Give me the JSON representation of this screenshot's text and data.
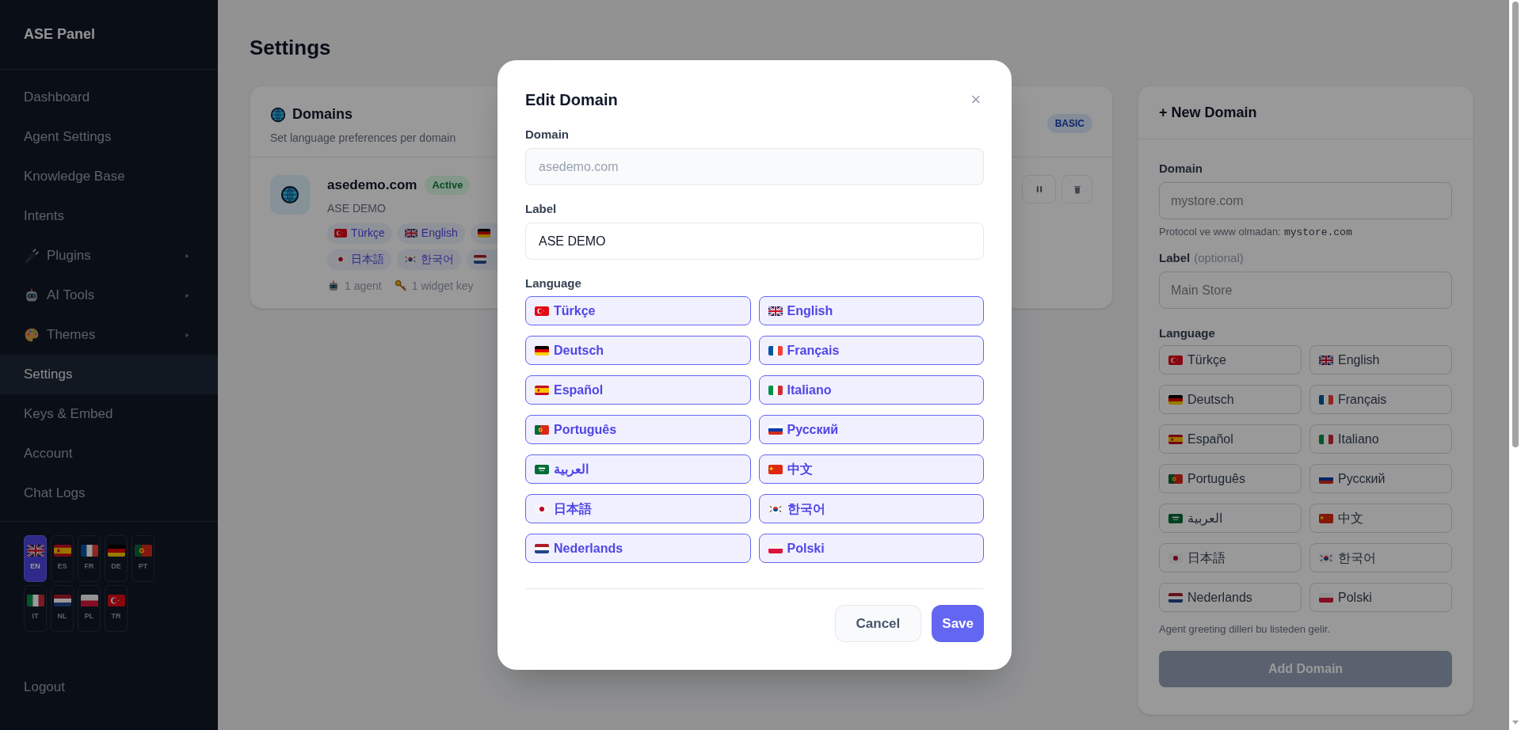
{
  "sidebar": {
    "title": "ASE Panel",
    "items": [
      {
        "label": "Dashboard",
        "kind": "link",
        "selected": false
      },
      {
        "label": "Agent Settings",
        "kind": "link",
        "selected": false
      },
      {
        "label": "Knowledge Base",
        "kind": "link",
        "selected": false
      },
      {
        "label": "Intents",
        "kind": "link",
        "selected": false
      },
      {
        "label": "Plugins",
        "kind": "plug",
        "selected": false
      },
      {
        "label": "AI Tools",
        "kind": "robot",
        "selected": false
      },
      {
        "label": "Themes",
        "kind": "palette",
        "selected": false
      },
      {
        "label": "Settings",
        "kind": "link",
        "selected": true
      },
      {
        "label": "Keys & Embed",
        "kind": "link",
        "selected": false
      },
      {
        "label": "Account",
        "kind": "link",
        "selected": false
      },
      {
        "label": "Chat Logs",
        "kind": "link",
        "selected": false
      }
    ],
    "languages": [
      {
        "code": "EN",
        "kind": "gb",
        "selected": true
      },
      {
        "code": "ES",
        "kind": "es",
        "selected": false
      },
      {
        "code": "FR",
        "kind": "fr",
        "selected": false
      },
      {
        "code": "DE",
        "kind": "de",
        "selected": false
      },
      {
        "code": "PT",
        "kind": "pt",
        "selected": false
      },
      {
        "code": "IT",
        "kind": "it",
        "selected": false
      },
      {
        "code": "NL",
        "kind": "nl",
        "selected": false
      },
      {
        "code": "PL",
        "kind": "pl",
        "selected": false
      },
      {
        "code": "TR",
        "kind": "tr",
        "selected": false
      }
    ],
    "logout": "Logout"
  },
  "page": {
    "title": "Settings"
  },
  "domains_card": {
    "title": "Domains",
    "subtitle": "Set language preferences per domain",
    "badge": "BASIC",
    "domain": {
      "name": "asedemo.com",
      "status": "Active",
      "label": "ASE DEMO",
      "language_rows": [
        [
          {
            "kind": "tr",
            "label": "Türkçe"
          },
          {
            "kind": "gb",
            "label": "English"
          },
          {
            "kind": "de"
          }
        ],
        [
          {
            "kind": "jp",
            "label": "日本語"
          },
          {
            "kind": "kr",
            "label": "한국어"
          },
          {
            "kind": "nl"
          }
        ]
      ],
      "agents": "1 agent",
      "keys": "1 widget key"
    }
  },
  "new_domain": {
    "title": "+ New Domain",
    "domain_label": "Domain",
    "domain_placeholder": "mystore.com",
    "hint": "Protocol ve www olmadan:",
    "hint_code": "mystore.com",
    "label_label": "Label",
    "label_optional": "(optional)",
    "label_placeholder": "Main Store",
    "language_label": "Language",
    "languages": [
      {
        "kind": "tr",
        "label": "Türkçe",
        "selected": false
      },
      {
        "kind": "gb",
        "label": "English",
        "selected": false
      },
      {
        "kind": "de",
        "label": "Deutsch",
        "selected": false
      },
      {
        "kind": "fr",
        "label": "Français",
        "selected": false
      },
      {
        "kind": "es",
        "label": "Español",
        "selected": false
      },
      {
        "kind": "it",
        "label": "Italiano",
        "selected": false
      },
      {
        "kind": "pt",
        "label": "Português",
        "selected": false
      },
      {
        "kind": "ru",
        "label": "Русский",
        "selected": false
      },
      {
        "kind": "sa",
        "label": "العربية",
        "selected": false
      },
      {
        "kind": "cn",
        "label": "中文",
        "selected": false
      },
      {
        "kind": "jp",
        "label": "日本語",
        "selected": false
      },
      {
        "kind": "kr",
        "label": "한국어",
        "selected": false
      },
      {
        "kind": "nl",
        "label": "Nederlands",
        "selected": false
      },
      {
        "kind": "pl",
        "label": "Polski",
        "selected": false
      }
    ],
    "note": "Agent greeting dilleri bu listeden gelir.",
    "add_button": "Add Domain",
    "add_disabled": true
  },
  "modal": {
    "title": "Edit Domain",
    "close": "×",
    "domain_label": "Domain",
    "domain_value": "asedemo.com",
    "domain_disabled": true,
    "label_label": "Label",
    "label_value": "ASE DEMO",
    "language_label": "Language",
    "languages": [
      {
        "kind": "tr",
        "label": "Türkçe",
        "selected": true
      },
      {
        "kind": "gb",
        "label": "English",
        "selected": true
      },
      {
        "kind": "de",
        "label": "Deutsch",
        "selected": true
      },
      {
        "kind": "fr",
        "label": "Français",
        "selected": true
      },
      {
        "kind": "es",
        "label": "Español",
        "selected": true
      },
      {
        "kind": "it",
        "label": "Italiano",
        "selected": true
      },
      {
        "kind": "pt",
        "label": "Português",
        "selected": true
      },
      {
        "kind": "ru",
        "label": "Русский",
        "selected": true
      },
      {
        "kind": "sa",
        "label": "العربية",
        "selected": true
      },
      {
        "kind": "cn",
        "label": "中文",
        "selected": true
      },
      {
        "kind": "jp",
        "label": "日本語",
        "selected": true
      },
      {
        "kind": "kr",
        "label": "한국어",
        "selected": true
      },
      {
        "kind": "nl",
        "label": "Nederlands",
        "selected": true
      },
      {
        "kind": "pl",
        "label": "Polski",
        "selected": true
      }
    ],
    "cancel": "Cancel",
    "save": "Save"
  }
}
